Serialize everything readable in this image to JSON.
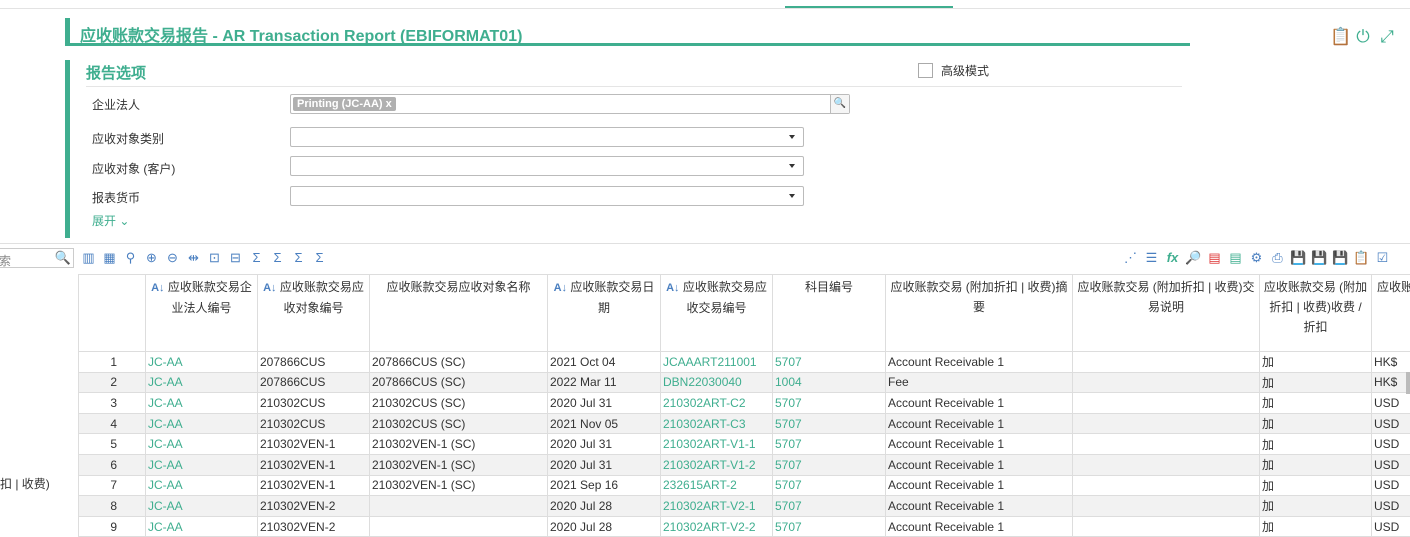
{
  "title": "应收账款交易报告 - AR Transaction Report (EBIFORMAT01)",
  "top_icons": [
    "clipboard-icon",
    "power-icon",
    "expand-icon"
  ],
  "options": {
    "title": "报告选项",
    "advanced_label": "高级模式",
    "fields": [
      {
        "label": "企业法人",
        "chip": "Printing (JC-AA)",
        "chip_x": "x"
      },
      {
        "label": "应收对象类别",
        "value": ""
      },
      {
        "label": "应收对象 (客户)",
        "value": ""
      },
      {
        "label": "报表货币",
        "value": ""
      }
    ],
    "expand_label": "展开 ⌄"
  },
  "toolbar": {
    "search_placeholder": "索",
    "left_icons": [
      "column-remove-icon",
      "table-remove-icon",
      "filter-icon",
      "add-icon",
      "remove-icon",
      "split-icon",
      "fit-icon",
      "width-icon",
      "sum-icon",
      "sum-remove-icon",
      "sum-view-icon",
      "sum-export-icon"
    ],
    "right_icons": [
      "chart-icon",
      "rows-icon",
      "formula-icon",
      "zoom-icon",
      "pdf-icon",
      "excel-icon",
      "print-settings-icon",
      "print-icon",
      "save-icon",
      "save-add-icon",
      "save-as-icon",
      "paste-icon",
      "check-icon"
    ]
  },
  "left_panel_label": "扣 | 收费)",
  "table": {
    "headers": [
      "",
      "应收账款交易企业法人编号",
      "应收账款交易应收对象编号",
      "应收账款交易应收对象名称",
      "应收账款交易日期",
      "应收账款交易应收交易编号",
      "科目编号",
      "应收账款交易 (附加折扣 | 收费)摘要",
      "应收账款交易 (附加折扣 | 收费)交易说明",
      "应收账款交易 (附加折扣 | 收费)收费 / 折扣",
      "应收账"
    ],
    "rows": [
      [
        "1",
        "JC-AA",
        "207866CUS",
        "207866CUS (SC)",
        "2021 Oct 04",
        "JCAAART211001",
        "5707",
        "Account Receivable 1",
        "",
        "加",
        "HK$"
      ],
      [
        "2",
        "JC-AA",
        "207866CUS",
        "207866CUS (SC)",
        "2022 Mar 11",
        "DBN22030040",
        "1004",
        "Fee",
        "",
        "加",
        "HK$"
      ],
      [
        "3",
        "JC-AA",
        "210302CUS",
        "210302CUS (SC)",
        "2020 Jul 31",
        "210302ART-C2",
        "5707",
        "Account Receivable 1",
        "",
        "加",
        "USD"
      ],
      [
        "4",
        "JC-AA",
        "210302CUS",
        "210302CUS (SC)",
        "2021 Nov 05",
        "210302ART-C3",
        "5707",
        "Account Receivable 1",
        "",
        "加",
        "USD"
      ],
      [
        "5",
        "JC-AA",
        "210302VEN-1",
        "210302VEN-1 (SC)",
        "2020 Jul 31",
        "210302ART-V1-1",
        "5707",
        "Account Receivable 1",
        "",
        "加",
        "USD"
      ],
      [
        "6",
        "JC-AA",
        "210302VEN-1",
        "210302VEN-1 (SC)",
        "2020 Jul 31",
        "210302ART-V1-2",
        "5707",
        "Account Receivable 1",
        "",
        "加",
        "USD"
      ],
      [
        "7",
        "JC-AA",
        "210302VEN-1",
        "210302VEN-1 (SC)",
        "2021 Sep 16",
        "232615ART-2",
        "5707",
        "Account Receivable 1",
        "",
        "加",
        "USD"
      ],
      [
        "8",
        "JC-AA",
        "210302VEN-2",
        "",
        "2020 Jul 28",
        "210302ART-V2-1",
        "5707",
        "Account Receivable 1",
        "",
        "加",
        "USD"
      ],
      [
        "9",
        "JC-AA",
        "210302VEN-2",
        "",
        "2020 Jul 28",
        "210302ART-V2-2",
        "5707",
        "Account Receivable 1",
        "",
        "加",
        "USD"
      ]
    ]
  }
}
